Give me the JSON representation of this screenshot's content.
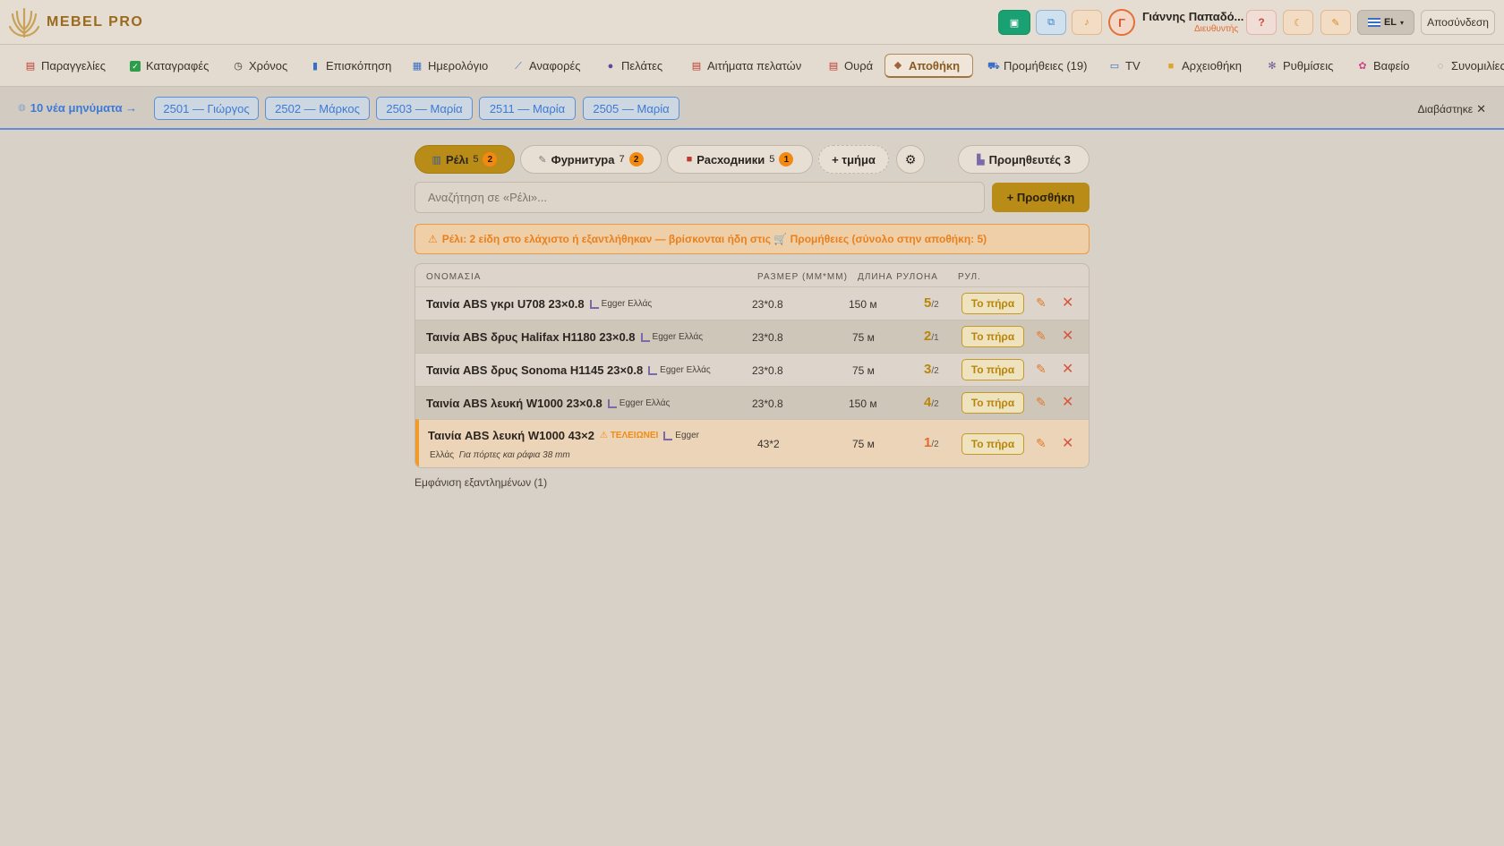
{
  "header": {
    "brand": "MEBEL PRO",
    "user_name": "Γιάννης Παπαδό...",
    "user_role": "Διευθυντής",
    "avatar_letter": "Γ",
    "language": "EL",
    "logout": "Αποσύνδεση",
    "help": "?"
  },
  "nav": [
    {
      "label": "Παραγγελίες",
      "icon": "clipboard-icon"
    },
    {
      "label": "Καταγραφές",
      "icon": "checkbox-icon"
    },
    {
      "label": "Χρόνος",
      "icon": "stopwatch-icon"
    },
    {
      "label": "Επισκόπηση",
      "icon": "bar-chart-icon"
    },
    {
      "label": "Ημερολόγιο",
      "icon": "calendar-icon"
    },
    {
      "label": "Αναφορές",
      "icon": "trend-icon"
    },
    {
      "label": "Πελάτες",
      "icon": "users-icon"
    },
    {
      "label": "Αιτήματα πελατών",
      "icon": "clipboard-icon"
    },
    {
      "label": "Ουρά",
      "icon": "clipboard-icon"
    },
    {
      "label": "Αποθήκη",
      "icon": "box-icon"
    },
    {
      "label": "Προμήθειες (19)",
      "icon": "cart-icon"
    },
    {
      "label": "TV",
      "icon": "tv-icon"
    },
    {
      "label": "Αρχειοθήκη",
      "icon": "folder-icon"
    },
    {
      "label": "Ρυθμίσεις",
      "icon": "gear-icon"
    },
    {
      "label": "Βαφείο",
      "icon": "palette-icon"
    },
    {
      "label": "Συνομιλίες",
      "icon": "chat-icon"
    }
  ],
  "messages": {
    "link": "10 νέα μηνύματα →",
    "chips": [
      "2501 — Γιώργος",
      "2502 — Μάρκος",
      "2503 — Μαρία",
      "2511 — Μαρία",
      "2505 — Μαρία"
    ],
    "dismiss": "Διαβάστηκε"
  },
  "tabs": [
    {
      "label": "Ρέλι",
      "count": "5",
      "badge": "2"
    },
    {
      "label": "Фурнитура",
      "count": "7",
      "badge": "2"
    },
    {
      "label": "Расходники",
      "count": "5",
      "badge": "1"
    },
    {
      "label": "+ τμήμα"
    },
    {
      "label": "Προμηθευτές 3"
    }
  ],
  "search": {
    "placeholder": "Αναζήτηση σε «Ρέλι»..."
  },
  "add_button": "+ Προσθήκη",
  "alert": "Ρέλι: 2 είδη στο ελάχιστο ή εξαντλήθηκαν — βρίσκονται ήδη στις 🛒 Προμήθειες (σύνολο στην αποθήκη: 5)",
  "table": {
    "headers": {
      "name": "ΟΝΟΜΑΣΙΑ",
      "size": "РАЗМЕР (ММ*ММ)",
      "length": "ДЛИНА РУЛОНА",
      "qty": "РУЛ."
    },
    "rows": [
      {
        "name": "Ταινία ABS γκρι U708 23×0.8",
        "supplier": "Egger Ελλάς",
        "size": "23*0.8",
        "length": "150 м",
        "qty": "5",
        "min": "/2"
      },
      {
        "name": "Ταινία ABS δρυς Halifax H1180 23×0.8",
        "supplier": "Egger Ελλάς",
        "size": "23*0.8",
        "length": "75 м",
        "qty": "2",
        "min": "/1"
      },
      {
        "name": "Ταινία ABS δρυς Sonoma H1145 23×0.8",
        "supplier": "Egger Ελλάς",
        "size": "23*0.8",
        "length": "75 м",
        "qty": "3",
        "min": "/2"
      },
      {
        "name": "Ταινία ABS λευκή W1000 23×0.8",
        "supplier": "Egger Ελλάς",
        "size": "23*0.8",
        "length": "150 м",
        "qty": "4",
        "min": "/2"
      },
      {
        "name": "Ταινία ABS λευκή W1000 43×2",
        "warning": "ΤΕΛΕΙΩΝΕΙ",
        "supplier_a": "Egger",
        "supplier_b": "Ελλάς",
        "note": "Για πόρτες και ράφια 38 mm",
        "size": "43*2",
        "length": "75 м",
        "qty": "1",
        "min": "/2"
      }
    ],
    "took_label": "Το πήρα"
  },
  "show_exhausted": "Εμφάνιση εξαντλημένων (1)"
}
